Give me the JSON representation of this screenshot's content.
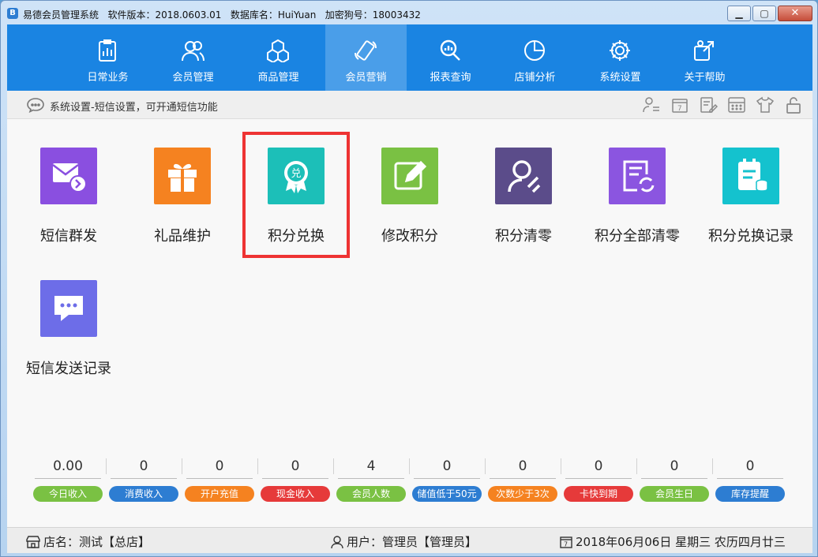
{
  "window": {
    "title": "易德会员管理系统   软件版本：2018.0603.01   数据库名：HuiYuan   加密狗号：18003432",
    "logo_letter": "B"
  },
  "nav": [
    {
      "label": "日常业务",
      "icon": "clipboard-chart-icon"
    },
    {
      "label": "会员管理",
      "icon": "users-icon"
    },
    {
      "label": "商品管理",
      "icon": "boxes-icon"
    },
    {
      "label": "会员营销",
      "icon": "phone-icon",
      "active": true
    },
    {
      "label": "报表查询",
      "icon": "search-report-icon"
    },
    {
      "label": "店铺分析",
      "icon": "pie-chart-icon"
    },
    {
      "label": "系统设置",
      "icon": "gear-icon"
    },
    {
      "label": "关于帮助",
      "icon": "help-icon"
    }
  ],
  "breadcrumb": "系统设置-短信设置，可开通短信功能",
  "functions": [
    {
      "label": "短信群发",
      "color": "#8a4fe0",
      "icon": "mail-send-icon"
    },
    {
      "label": "礼品维护",
      "color": "#f58220",
      "icon": "gift-icon"
    },
    {
      "label": "积分兑换",
      "color": "#1cbfb8",
      "icon": "redeem-badge-icon",
      "badge_char": "兑"
    },
    {
      "label": "修改积分",
      "color": "#7ac143",
      "icon": "edit-icon"
    },
    {
      "label": "积分清零",
      "color": "#5b4c8a",
      "icon": "user-clear-icon"
    },
    {
      "label": "积分全部清零",
      "color": "#8b55e0",
      "icon": "refresh-doc-icon"
    },
    {
      "label": "积分兑换记录",
      "color": "#14c2ce",
      "icon": "record-db-icon"
    },
    {
      "label": "短信发送记录",
      "color": "#6d6de8",
      "icon": "chat-icon"
    }
  ],
  "stats": [
    {
      "value": "0.00",
      "label": "今日收入",
      "color": "#7ac143"
    },
    {
      "value": "0",
      "label": "消费收入",
      "color": "#2d7dd2"
    },
    {
      "value": "0",
      "label": "开户充值",
      "color": "#f58220"
    },
    {
      "value": "0",
      "label": "现金收入",
      "color": "#e63a3a"
    },
    {
      "value": "4",
      "label": "会员人数",
      "color": "#7ac143"
    },
    {
      "value": "0",
      "label": "储值低于50元",
      "color": "#2d7dd2"
    },
    {
      "value": "0",
      "label": "次数少于3次",
      "color": "#f58220"
    },
    {
      "value": "0",
      "label": "卡快到期",
      "color": "#e63a3a"
    },
    {
      "value": "0",
      "label": "会员生日",
      "color": "#7ac143"
    },
    {
      "value": "0",
      "label": "库存提醒",
      "color": "#2d7dd2"
    }
  ],
  "status": {
    "store": "店名：测试【总店】",
    "user": "用户：管理员【管理员】",
    "date": "2018年06月06日 星期三 农历四月廿三"
  }
}
